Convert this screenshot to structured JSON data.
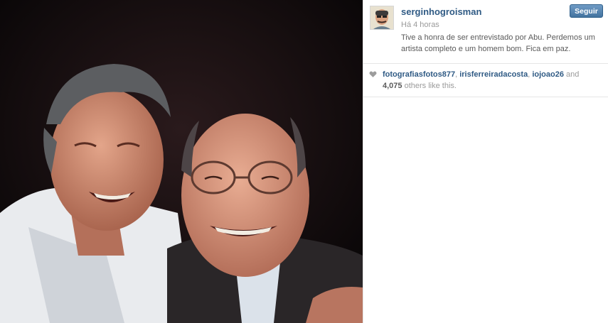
{
  "post": {
    "username": "serginhogroisman",
    "timestamp": "Há 4 horas",
    "caption": "Tive a honra de ser entrevistado por Abu. Perdemos um artista completo e um homem bom. Fica em paz.",
    "follow_label": "Seguir"
  },
  "likes": {
    "users": [
      "fotografiasfotos877",
      "irisferreiradacosta",
      "iojoao26"
    ],
    "sep1": ", ",
    "sep2": ", ",
    "and_text": " and",
    "count": "4,075",
    "others_text": " others like this."
  },
  "colors": {
    "link": "#2f5a84",
    "button": "#4f7fae",
    "muted": "#9a9a9a"
  },
  "icons": [
    "heart-icon"
  ]
}
